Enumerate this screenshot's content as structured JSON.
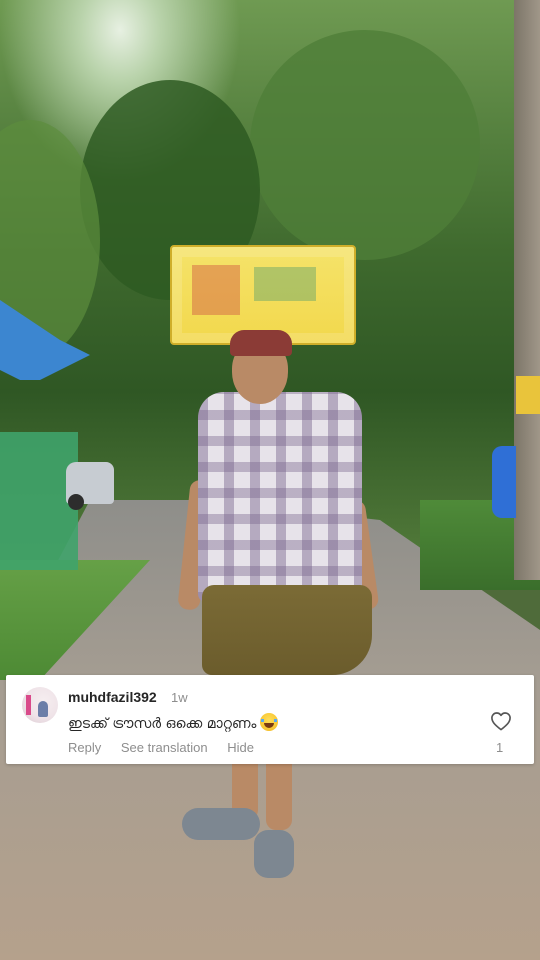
{
  "comment": {
    "username": "muhdfazil392",
    "time_ago": "1w",
    "text": "ഇടക്ക് ട്രൗസർ ഒക്കെ മാറ്റണം",
    "emoji": "face-with-tears-of-joy",
    "actions": {
      "reply": "Reply",
      "see_translation": "See translation",
      "hide": "Hide"
    },
    "like_count": "1"
  },
  "colors": {
    "card_bg": "#ffffff",
    "text_primary": "#262626",
    "text_secondary": "#8e8e8e"
  }
}
